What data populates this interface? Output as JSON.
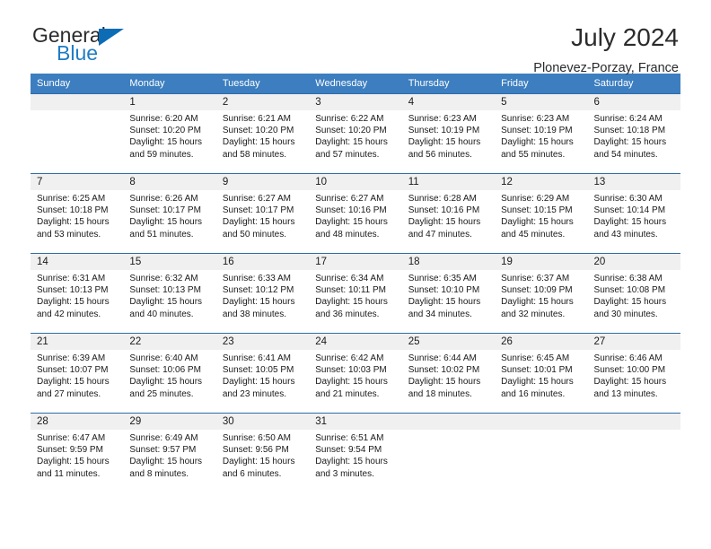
{
  "brand": {
    "name_part1": "General",
    "name_part2": "Blue",
    "accent_color": "#1f7cc4",
    "triangle_color": "#0d6cb6",
    "logo_icon": "triangle-icon"
  },
  "header": {
    "title": "July 2024",
    "subtitle": "Plonevez-Porzay, France"
  },
  "theme": {
    "header_row_bg": "#3c7ebf",
    "row_divider": "#2f6ca8",
    "daynum_bg": "#f0f0f0",
    "text": "#1a1a1a"
  },
  "columns": [
    "Sunday",
    "Monday",
    "Tuesday",
    "Wednesday",
    "Thursday",
    "Friday",
    "Saturday"
  ],
  "weeks": [
    [
      {
        "day": "",
        "sunrise": "",
        "sunset": "",
        "daylight_line1": "",
        "daylight_line2": ""
      },
      {
        "day": "1",
        "sunrise": "Sunrise: 6:20 AM",
        "sunset": "Sunset: 10:20 PM",
        "daylight_line1": "Daylight: 15 hours",
        "daylight_line2": "and 59 minutes."
      },
      {
        "day": "2",
        "sunrise": "Sunrise: 6:21 AM",
        "sunset": "Sunset: 10:20 PM",
        "daylight_line1": "Daylight: 15 hours",
        "daylight_line2": "and 58 minutes."
      },
      {
        "day": "3",
        "sunrise": "Sunrise: 6:22 AM",
        "sunset": "Sunset: 10:20 PM",
        "daylight_line1": "Daylight: 15 hours",
        "daylight_line2": "and 57 minutes."
      },
      {
        "day": "4",
        "sunrise": "Sunrise: 6:23 AM",
        "sunset": "Sunset: 10:19 PM",
        "daylight_line1": "Daylight: 15 hours",
        "daylight_line2": "and 56 minutes."
      },
      {
        "day": "5",
        "sunrise": "Sunrise: 6:23 AM",
        "sunset": "Sunset: 10:19 PM",
        "daylight_line1": "Daylight: 15 hours",
        "daylight_line2": "and 55 minutes."
      },
      {
        "day": "6",
        "sunrise": "Sunrise: 6:24 AM",
        "sunset": "Sunset: 10:18 PM",
        "daylight_line1": "Daylight: 15 hours",
        "daylight_line2": "and 54 minutes."
      }
    ],
    [
      {
        "day": "7",
        "sunrise": "Sunrise: 6:25 AM",
        "sunset": "Sunset: 10:18 PM",
        "daylight_line1": "Daylight: 15 hours",
        "daylight_line2": "and 53 minutes."
      },
      {
        "day": "8",
        "sunrise": "Sunrise: 6:26 AM",
        "sunset": "Sunset: 10:17 PM",
        "daylight_line1": "Daylight: 15 hours",
        "daylight_line2": "and 51 minutes."
      },
      {
        "day": "9",
        "sunrise": "Sunrise: 6:27 AM",
        "sunset": "Sunset: 10:17 PM",
        "daylight_line1": "Daylight: 15 hours",
        "daylight_line2": "and 50 minutes."
      },
      {
        "day": "10",
        "sunrise": "Sunrise: 6:27 AM",
        "sunset": "Sunset: 10:16 PM",
        "daylight_line1": "Daylight: 15 hours",
        "daylight_line2": "and 48 minutes."
      },
      {
        "day": "11",
        "sunrise": "Sunrise: 6:28 AM",
        "sunset": "Sunset: 10:16 PM",
        "daylight_line1": "Daylight: 15 hours",
        "daylight_line2": "and 47 minutes."
      },
      {
        "day": "12",
        "sunrise": "Sunrise: 6:29 AM",
        "sunset": "Sunset: 10:15 PM",
        "daylight_line1": "Daylight: 15 hours",
        "daylight_line2": "and 45 minutes."
      },
      {
        "day": "13",
        "sunrise": "Sunrise: 6:30 AM",
        "sunset": "Sunset: 10:14 PM",
        "daylight_line1": "Daylight: 15 hours",
        "daylight_line2": "and 43 minutes."
      }
    ],
    [
      {
        "day": "14",
        "sunrise": "Sunrise: 6:31 AM",
        "sunset": "Sunset: 10:13 PM",
        "daylight_line1": "Daylight: 15 hours",
        "daylight_line2": "and 42 minutes."
      },
      {
        "day": "15",
        "sunrise": "Sunrise: 6:32 AM",
        "sunset": "Sunset: 10:13 PM",
        "daylight_line1": "Daylight: 15 hours",
        "daylight_line2": "and 40 minutes."
      },
      {
        "day": "16",
        "sunrise": "Sunrise: 6:33 AM",
        "sunset": "Sunset: 10:12 PM",
        "daylight_line1": "Daylight: 15 hours",
        "daylight_line2": "and 38 minutes."
      },
      {
        "day": "17",
        "sunrise": "Sunrise: 6:34 AM",
        "sunset": "Sunset: 10:11 PM",
        "daylight_line1": "Daylight: 15 hours",
        "daylight_line2": "and 36 minutes."
      },
      {
        "day": "18",
        "sunrise": "Sunrise: 6:35 AM",
        "sunset": "Sunset: 10:10 PM",
        "daylight_line1": "Daylight: 15 hours",
        "daylight_line2": "and 34 minutes."
      },
      {
        "day": "19",
        "sunrise": "Sunrise: 6:37 AM",
        "sunset": "Sunset: 10:09 PM",
        "daylight_line1": "Daylight: 15 hours",
        "daylight_line2": "and 32 minutes."
      },
      {
        "day": "20",
        "sunrise": "Sunrise: 6:38 AM",
        "sunset": "Sunset: 10:08 PM",
        "daylight_line1": "Daylight: 15 hours",
        "daylight_line2": "and 30 minutes."
      }
    ],
    [
      {
        "day": "21",
        "sunrise": "Sunrise: 6:39 AM",
        "sunset": "Sunset: 10:07 PM",
        "daylight_line1": "Daylight: 15 hours",
        "daylight_line2": "and 27 minutes."
      },
      {
        "day": "22",
        "sunrise": "Sunrise: 6:40 AM",
        "sunset": "Sunset: 10:06 PM",
        "daylight_line1": "Daylight: 15 hours",
        "daylight_line2": "and 25 minutes."
      },
      {
        "day": "23",
        "sunrise": "Sunrise: 6:41 AM",
        "sunset": "Sunset: 10:05 PM",
        "daylight_line1": "Daylight: 15 hours",
        "daylight_line2": "and 23 minutes."
      },
      {
        "day": "24",
        "sunrise": "Sunrise: 6:42 AM",
        "sunset": "Sunset: 10:03 PM",
        "daylight_line1": "Daylight: 15 hours",
        "daylight_line2": "and 21 minutes."
      },
      {
        "day": "25",
        "sunrise": "Sunrise: 6:44 AM",
        "sunset": "Sunset: 10:02 PM",
        "daylight_line1": "Daylight: 15 hours",
        "daylight_line2": "and 18 minutes."
      },
      {
        "day": "26",
        "sunrise": "Sunrise: 6:45 AM",
        "sunset": "Sunset: 10:01 PM",
        "daylight_line1": "Daylight: 15 hours",
        "daylight_line2": "and 16 minutes."
      },
      {
        "day": "27",
        "sunrise": "Sunrise: 6:46 AM",
        "sunset": "Sunset: 10:00 PM",
        "daylight_line1": "Daylight: 15 hours",
        "daylight_line2": "and 13 minutes."
      }
    ],
    [
      {
        "day": "28",
        "sunrise": "Sunrise: 6:47 AM",
        "sunset": "Sunset: 9:59 PM",
        "daylight_line1": "Daylight: 15 hours",
        "daylight_line2": "and 11 minutes."
      },
      {
        "day": "29",
        "sunrise": "Sunrise: 6:49 AM",
        "sunset": "Sunset: 9:57 PM",
        "daylight_line1": "Daylight: 15 hours",
        "daylight_line2": "and 8 minutes."
      },
      {
        "day": "30",
        "sunrise": "Sunrise: 6:50 AM",
        "sunset": "Sunset: 9:56 PM",
        "daylight_line1": "Daylight: 15 hours",
        "daylight_line2": "and 6 minutes."
      },
      {
        "day": "31",
        "sunrise": "Sunrise: 6:51 AM",
        "sunset": "Sunset: 9:54 PM",
        "daylight_line1": "Daylight: 15 hours",
        "daylight_line2": "and 3 minutes."
      },
      {
        "day": "",
        "sunrise": "",
        "sunset": "",
        "daylight_line1": "",
        "daylight_line2": ""
      },
      {
        "day": "",
        "sunrise": "",
        "sunset": "",
        "daylight_line1": "",
        "daylight_line2": ""
      },
      {
        "day": "",
        "sunrise": "",
        "sunset": "",
        "daylight_line1": "",
        "daylight_line2": ""
      }
    ]
  ]
}
